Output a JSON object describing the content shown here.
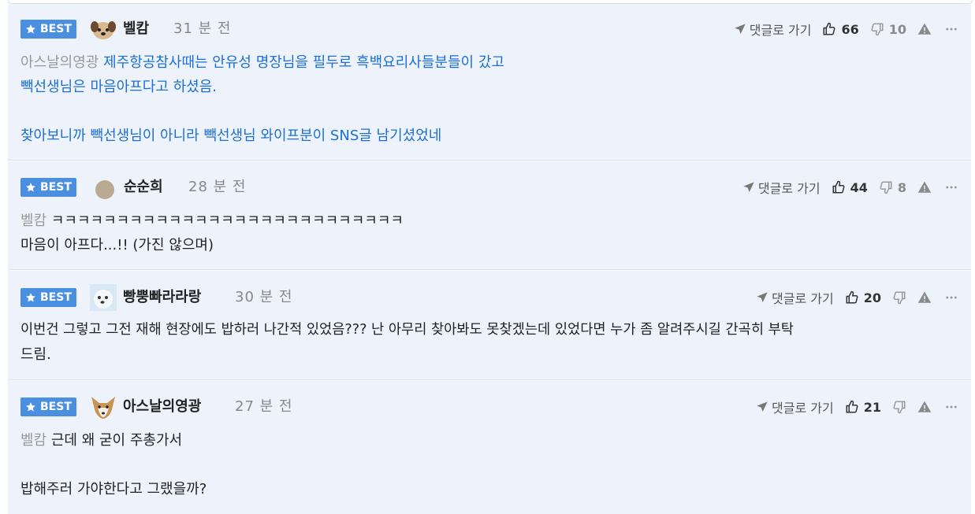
{
  "badge_label": "BEST",
  "reply_label": "댓글로 가기",
  "colors": {
    "badge": "#4a8fe0",
    "card_bg": "#eef3fb",
    "link_text": "#1c6fd6"
  },
  "comments": [
    {
      "nickname": "벨캄",
      "time": "31 분 전",
      "likes": "66",
      "dislikes": "10",
      "mention": "아스날의영광",
      "lines": [
        "제주항공참사때는 안유성 명장님을 필두로 흑백요리사들분들이 갔고",
        "빽선생님은 마음아프다고 하셨음.",
        "",
        "찾아보니까 빽선생님이 아니라 빽선생님 와이프분이 SNS글 남기셨었네"
      ]
    },
    {
      "nickname": "순순희",
      "time": "28 분 전",
      "likes": "44",
      "dislikes": "8",
      "mention": "벨캄",
      "lines": [
        "ㅋㅋㅋㅋㅋㅋㅋㅋㅋㅋㅋㅋㅋㅋㅋㅋㅋㅋㅋㅋㅋㅋㅋㅋㅋㅋㅋ",
        "마음이 아프다...!! (가진 않으며)"
      ]
    },
    {
      "nickname": "빵뿡빠라라랑",
      "time": "30 분 전",
      "likes": "20",
      "dislikes": "",
      "mention": "",
      "lines": [
        "이번건 그렇고 그전 재해 현장에도 밥하러 나간적 있었음??? 난 아무리 찾아봐도 못찾겠는데 있었다면 누가 좀 알려주시길 간곡히 부탁",
        "드림."
      ]
    },
    {
      "nickname": "아스날의영광",
      "time": "27 분 전",
      "likes": "21",
      "dislikes": "",
      "mention": "벨캄",
      "lines": [
        "근데 왜 굳이 주총가서",
        "",
        "밥해주러 가야한다고 그랬을까?"
      ]
    }
  ]
}
